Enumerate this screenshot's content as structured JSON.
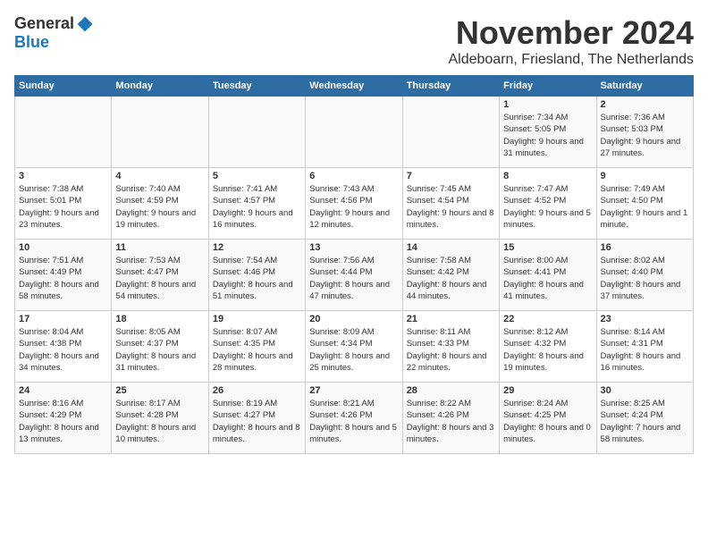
{
  "logo": {
    "general": "General",
    "blue": "Blue"
  },
  "title": "November 2024",
  "location": "Aldeboarn, Friesland, The Netherlands",
  "days_of_week": [
    "Sunday",
    "Monday",
    "Tuesday",
    "Wednesday",
    "Thursday",
    "Friday",
    "Saturday"
  ],
  "weeks": [
    [
      {
        "day": "",
        "content": ""
      },
      {
        "day": "",
        "content": ""
      },
      {
        "day": "",
        "content": ""
      },
      {
        "day": "",
        "content": ""
      },
      {
        "day": "",
        "content": ""
      },
      {
        "day": "1",
        "content": "Sunrise: 7:34 AM\nSunset: 5:05 PM\nDaylight: 9 hours and 31 minutes."
      },
      {
        "day": "2",
        "content": "Sunrise: 7:36 AM\nSunset: 5:03 PM\nDaylight: 9 hours and 27 minutes."
      }
    ],
    [
      {
        "day": "3",
        "content": "Sunrise: 7:38 AM\nSunset: 5:01 PM\nDaylight: 9 hours and 23 minutes."
      },
      {
        "day": "4",
        "content": "Sunrise: 7:40 AM\nSunset: 4:59 PM\nDaylight: 9 hours and 19 minutes."
      },
      {
        "day": "5",
        "content": "Sunrise: 7:41 AM\nSunset: 4:57 PM\nDaylight: 9 hours and 16 minutes."
      },
      {
        "day": "6",
        "content": "Sunrise: 7:43 AM\nSunset: 4:56 PM\nDaylight: 9 hours and 12 minutes."
      },
      {
        "day": "7",
        "content": "Sunrise: 7:45 AM\nSunset: 4:54 PM\nDaylight: 9 hours and 8 minutes."
      },
      {
        "day": "8",
        "content": "Sunrise: 7:47 AM\nSunset: 4:52 PM\nDaylight: 9 hours and 5 minutes."
      },
      {
        "day": "9",
        "content": "Sunrise: 7:49 AM\nSunset: 4:50 PM\nDaylight: 9 hours and 1 minute."
      }
    ],
    [
      {
        "day": "10",
        "content": "Sunrise: 7:51 AM\nSunset: 4:49 PM\nDaylight: 8 hours and 58 minutes."
      },
      {
        "day": "11",
        "content": "Sunrise: 7:53 AM\nSunset: 4:47 PM\nDaylight: 8 hours and 54 minutes."
      },
      {
        "day": "12",
        "content": "Sunrise: 7:54 AM\nSunset: 4:46 PM\nDaylight: 8 hours and 51 minutes."
      },
      {
        "day": "13",
        "content": "Sunrise: 7:56 AM\nSunset: 4:44 PM\nDaylight: 8 hours and 47 minutes."
      },
      {
        "day": "14",
        "content": "Sunrise: 7:58 AM\nSunset: 4:42 PM\nDaylight: 8 hours and 44 minutes."
      },
      {
        "day": "15",
        "content": "Sunrise: 8:00 AM\nSunset: 4:41 PM\nDaylight: 8 hours and 41 minutes."
      },
      {
        "day": "16",
        "content": "Sunrise: 8:02 AM\nSunset: 4:40 PM\nDaylight: 8 hours and 37 minutes."
      }
    ],
    [
      {
        "day": "17",
        "content": "Sunrise: 8:04 AM\nSunset: 4:38 PM\nDaylight: 8 hours and 34 minutes."
      },
      {
        "day": "18",
        "content": "Sunrise: 8:05 AM\nSunset: 4:37 PM\nDaylight: 8 hours and 31 minutes."
      },
      {
        "day": "19",
        "content": "Sunrise: 8:07 AM\nSunset: 4:35 PM\nDaylight: 8 hours and 28 minutes."
      },
      {
        "day": "20",
        "content": "Sunrise: 8:09 AM\nSunset: 4:34 PM\nDaylight: 8 hours and 25 minutes."
      },
      {
        "day": "21",
        "content": "Sunrise: 8:11 AM\nSunset: 4:33 PM\nDaylight: 8 hours and 22 minutes."
      },
      {
        "day": "22",
        "content": "Sunrise: 8:12 AM\nSunset: 4:32 PM\nDaylight: 8 hours and 19 minutes."
      },
      {
        "day": "23",
        "content": "Sunrise: 8:14 AM\nSunset: 4:31 PM\nDaylight: 8 hours and 16 minutes."
      }
    ],
    [
      {
        "day": "24",
        "content": "Sunrise: 8:16 AM\nSunset: 4:29 PM\nDaylight: 8 hours and 13 minutes."
      },
      {
        "day": "25",
        "content": "Sunrise: 8:17 AM\nSunset: 4:28 PM\nDaylight: 8 hours and 10 minutes."
      },
      {
        "day": "26",
        "content": "Sunrise: 8:19 AM\nSunset: 4:27 PM\nDaylight: 8 hours and 8 minutes."
      },
      {
        "day": "27",
        "content": "Sunrise: 8:21 AM\nSunset: 4:26 PM\nDaylight: 8 hours and 5 minutes."
      },
      {
        "day": "28",
        "content": "Sunrise: 8:22 AM\nSunset: 4:26 PM\nDaylight: 8 hours and 3 minutes."
      },
      {
        "day": "29",
        "content": "Sunrise: 8:24 AM\nSunset: 4:25 PM\nDaylight: 8 hours and 0 minutes."
      },
      {
        "day": "30",
        "content": "Sunrise: 8:25 AM\nSunset: 4:24 PM\nDaylight: 7 hours and 58 minutes."
      }
    ]
  ]
}
